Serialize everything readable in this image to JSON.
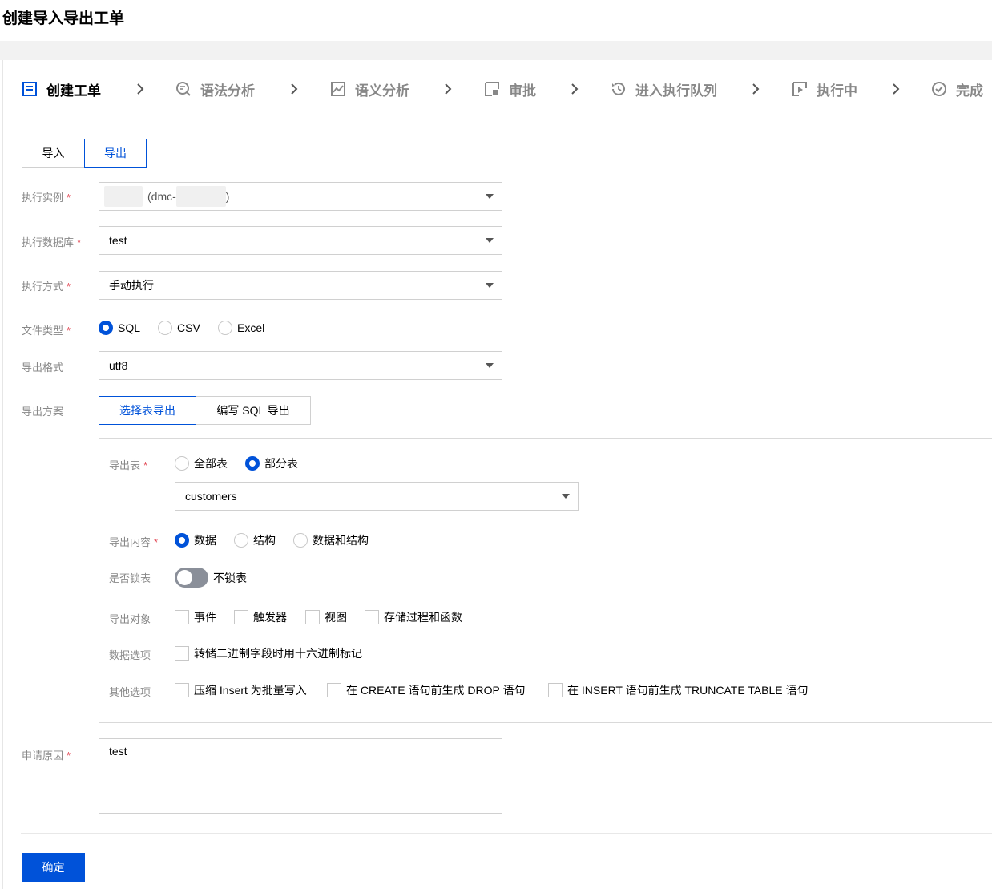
{
  "page_title": "创建导入导出工单",
  "steps": [
    {
      "label": "创建工单",
      "icon": "form-icon",
      "active": true
    },
    {
      "label": "语法分析",
      "icon": "search-doc-icon",
      "active": false
    },
    {
      "label": "语义分析",
      "icon": "chart-image-icon",
      "active": false
    },
    {
      "label": "审批",
      "icon": "approval-icon",
      "active": false
    },
    {
      "label": "进入执行队列",
      "icon": "history-icon",
      "active": false
    },
    {
      "label": "执行中",
      "icon": "play-box-icon",
      "active": false
    },
    {
      "label": "完成",
      "icon": "check-circle-icon",
      "active": false
    }
  ],
  "mode_tabs": {
    "import": "导入",
    "export": "导出",
    "selected": "导出"
  },
  "form": {
    "instance": {
      "label": "执行实例",
      "value_mid": "(dmc-",
      "value_end": ")"
    },
    "database": {
      "label": "执行数据库",
      "value": "test"
    },
    "exec_mode": {
      "label": "执行方式",
      "value": "手动执行"
    },
    "file_type": {
      "label": "文件类型",
      "options": [
        "SQL",
        "CSV",
        "Excel"
      ],
      "selected": "SQL"
    },
    "export_format": {
      "label": "导出格式",
      "value": "utf8"
    },
    "export_plan": {
      "label": "导出方案",
      "options": [
        "选择表导出",
        "编写 SQL 导出"
      ],
      "selected": "选择表导出"
    },
    "export_tables": {
      "label": "导出表",
      "options": [
        "全部表",
        "部分表"
      ],
      "selected": "部分表",
      "table_value": "customers"
    },
    "export_content": {
      "label": "导出内容",
      "options": [
        "数据",
        "结构",
        "数据和结构"
      ],
      "selected": "数据"
    },
    "lock_table": {
      "label": "是否锁表",
      "state_text": "不锁表",
      "on": false
    },
    "export_objects": {
      "label": "导出对象",
      "options": [
        "事件",
        "触发器",
        "视图",
        "存储过程和函数"
      ]
    },
    "data_options": {
      "label": "数据选项",
      "options": [
        "转储二进制字段时用十六进制标记"
      ]
    },
    "other_options": {
      "label": "其他选项",
      "options": [
        "压缩 Insert 为批量写入",
        "在 CREATE 语句前生成 DROP 语句",
        "在 INSERT 语句前生成 TRUNCATE TABLE 语句"
      ]
    },
    "reason": {
      "label": "申请原因",
      "value": "test"
    }
  },
  "submit_label": "确定",
  "colors": {
    "primary": "#0052d9",
    "required": "#e34d59",
    "muted": "#888888"
  }
}
